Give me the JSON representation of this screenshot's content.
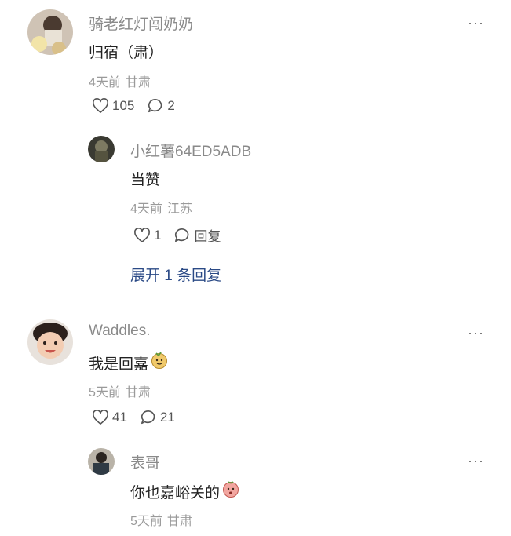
{
  "comments": [
    {
      "user": "骑老红灯闯奶奶",
      "text": "归宿（肃）",
      "time": "4天前",
      "location": "甘肃",
      "likes": "105",
      "replies_count": "2",
      "more": "···",
      "replies": [
        {
          "user": "小红薯64ED5ADB",
          "text": "当赞",
          "time": "4天前",
          "location": "江苏",
          "likes": "1",
          "reply_label": "回复"
        }
      ],
      "expand_label": "展开 1 条回复"
    },
    {
      "user": "Waddles.",
      "text": "我是回嘉",
      "time": "5天前",
      "location": "甘肃",
      "likes": "41",
      "replies_count": "21",
      "more": "···",
      "replies": [
        {
          "user": "表哥",
          "text": "你也嘉峪关的",
          "time": "5天前",
          "location": "甘肃",
          "more": "···"
        }
      ]
    }
  ],
  "icons": {
    "like": "heart-outline-icon",
    "comment": "speech-bubble-icon",
    "more": "ellipsis-icon"
  },
  "colors": {
    "link": "#2b4a86",
    "meta": "#9a9a9a",
    "username": "#8a8a8a"
  }
}
